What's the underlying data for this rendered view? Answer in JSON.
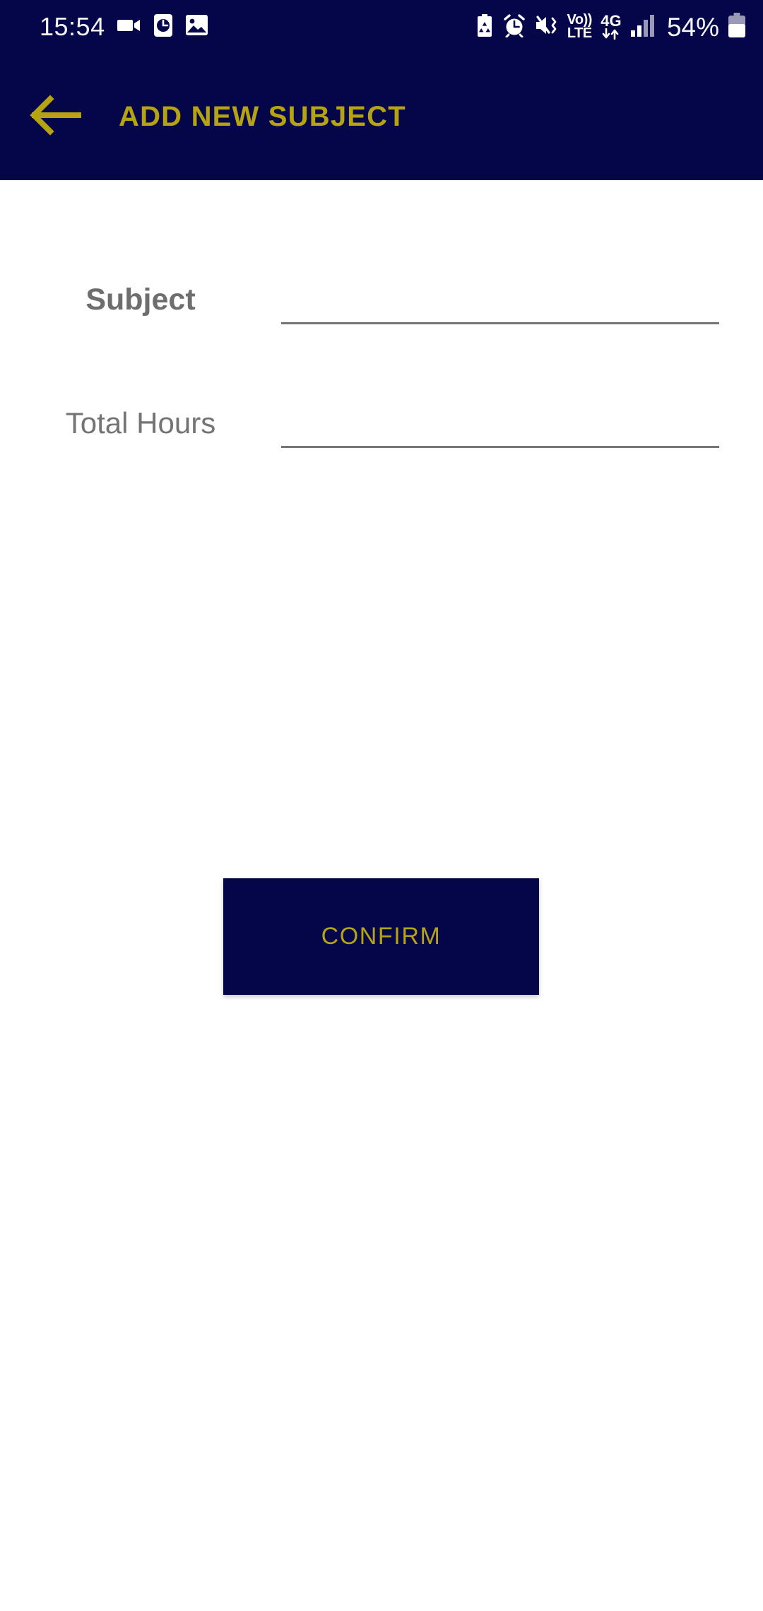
{
  "status_bar": {
    "time": "15:54",
    "battery_percent": "54%",
    "network_volte_top": "Vo))",
    "network_volte_bottom": "LTE",
    "network_generation": "4G",
    "left_icons": [
      "video-camera-icon",
      "clock-badge-icon",
      "gallery-image-icon"
    ],
    "right_icons": [
      "battery-saver-recycle-icon",
      "alarm-clock-icon",
      "mute-vibrate-icon",
      "volte-icon",
      "data-transfer-icon",
      "signal-bars-icon",
      "battery-icon"
    ],
    "background_color": "#05054a",
    "foreground_color": "#f2f2f7"
  },
  "app_bar": {
    "back_icon": "arrow-left-icon",
    "title": "ADD NEW SUBJECT",
    "background_color": "#05054a",
    "accent_color": "#b5a312"
  },
  "form": {
    "fields": [
      {
        "label": "Subject",
        "value": "",
        "placeholder": "",
        "emphasis": "bold"
      },
      {
        "label": "Total Hours",
        "value": "",
        "placeholder": "",
        "emphasis": "normal"
      }
    ]
  },
  "actions": {
    "confirm_label": "CONFIRM",
    "confirm_background": "#05054a",
    "confirm_text_color": "#b5a312"
  }
}
